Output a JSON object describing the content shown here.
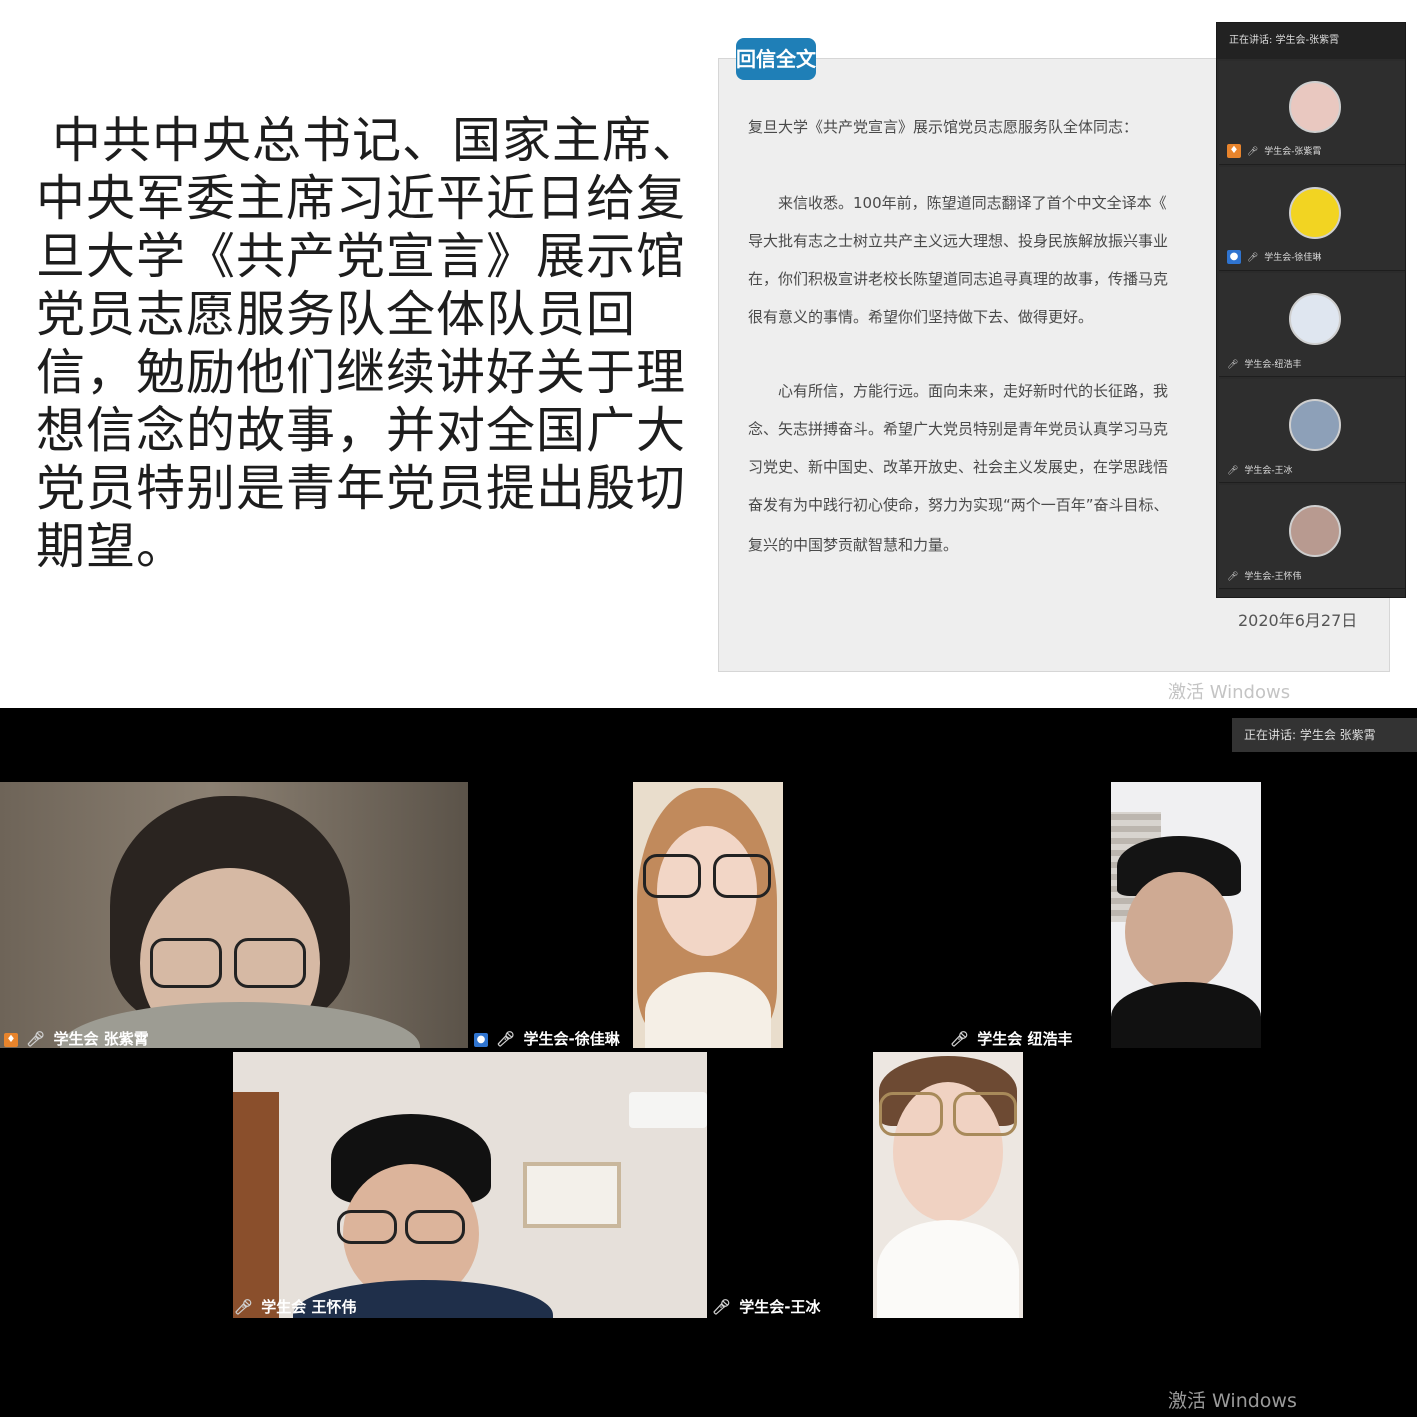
{
  "slide": {
    "body": "中共中央总书记、国家主席、中央军委主席习近平近日给复旦大学《共产党宣言》展示馆党员志愿服务队全体队员回信，勉励他们继续讲好关于理想信念的故事，并对全国广大党员特别是青年党员提出殷切期望。",
    "letter": {
      "badge": "回信全文",
      "lines": [
        "复旦大学《共产党宣言》展示馆党员志愿服务队全体同志：",
        "",
        "　　来信收悉。100年前，陈望道同志翻译了首个中文全译本《",
        "导大批有志之士树立共产主义远大理想、投身民族解放振兴事业",
        "在，你们积极宣讲老校长陈望道同志追寻真理的故事，传播马克",
        "很有意义的事情。希望你们坚持做下去、做得更好。",
        "",
        "　　心有所信，方能行远。面向未来，走好新时代的长征路，我",
        "念、矢志拼搏奋斗。希望广大党员特别是青年党员认真学习马克",
        "习党史、新中国史、改革开放史、社会主义发展史，在学思践悟",
        "奋发有为中践行初心使命，努力为实现“两个一百年”奋斗目标、",
        "复兴的中国梦贡献智慧和力量。"
      ],
      "date": "2020年6月27日"
    },
    "watermark": "激活 Windows"
  },
  "side_panel": {
    "header": "正在讲话: 学生会-张紫霄",
    "participants": [
      {
        "label": "学生会-张紫霄",
        "avatar_color": "#e9c8c0"
      },
      {
        "label": "学生会-徐佳琳",
        "avatar_color": "#f2d422"
      },
      {
        "label": "学生会-纽浩丰",
        "avatar_color": "#dfe6f0"
      },
      {
        "label": "学生会-王冰",
        "avatar_color": "#8da0b8"
      },
      {
        "label": "学生会-王怀伟",
        "avatar_color": "#b89a90"
      }
    ]
  },
  "call": {
    "speaking": "正在讲话: 学生会 张紫霄",
    "tiles": [
      {
        "label": "学生会 张紫霄"
      },
      {
        "label": "学生会-徐佳琳"
      },
      {
        "label": "学生会 纽浩丰"
      },
      {
        "label": "学生会 王怀伟"
      },
      {
        "label": "学生会-王冰"
      }
    ],
    "watermark": "激活 Windows"
  }
}
